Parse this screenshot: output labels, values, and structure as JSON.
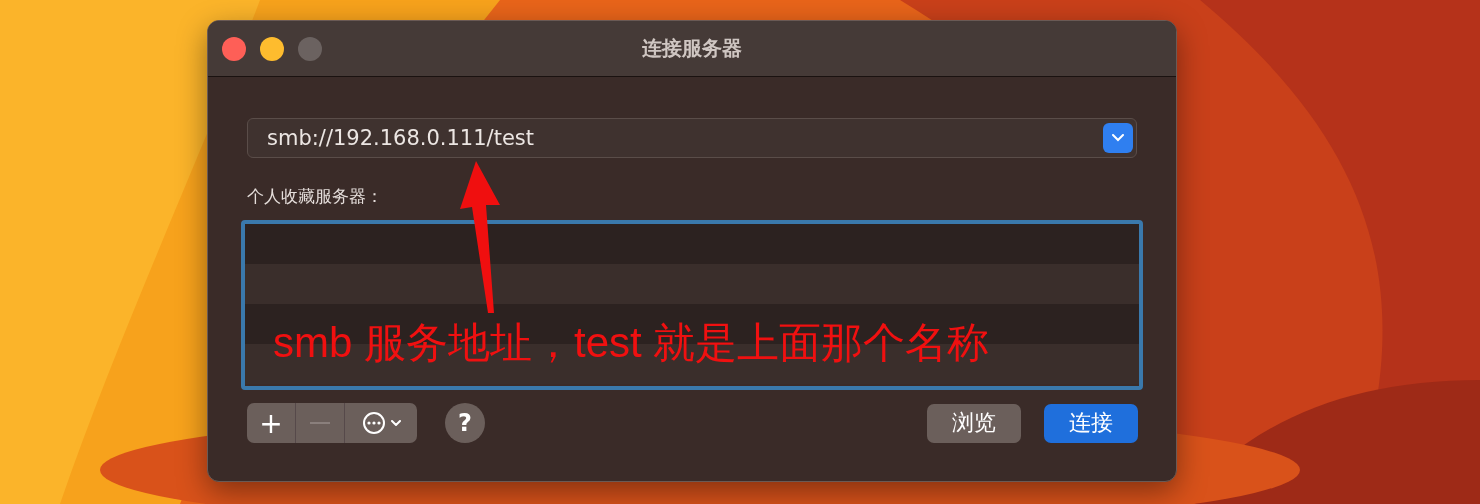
{
  "window": {
    "title": "连接服务器"
  },
  "server_address": {
    "value": "smb://192.168.0.111/test"
  },
  "favorites": {
    "label": "个人收藏服务器："
  },
  "toolbar": {
    "add": "+",
    "remove_disabled": true
  },
  "help": "?",
  "buttons": [
    {
      "label": "浏览",
      "kind": "secondary"
    },
    {
      "label": "连接",
      "kind": "primary"
    }
  ],
  "annotation": {
    "text": "smb 服务地址，test 就是上面那个名称"
  }
}
